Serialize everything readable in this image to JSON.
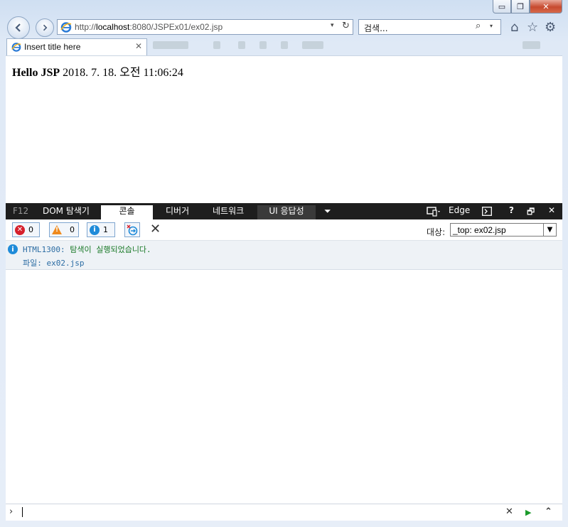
{
  "window": {
    "controls": {
      "minimize": "▭",
      "maximize": "❐",
      "close": "✕"
    }
  },
  "toolbar": {
    "back_icon": "arrow-left-icon",
    "forward_icon": "arrow-right-icon",
    "address": {
      "prefix": "http://",
      "host": "localhost",
      "rest": ":8080/JSPEx01/ex02.jsp",
      "dropdown": "▾",
      "refresh": "↻"
    },
    "search": {
      "placeholder": "검색...",
      "icon": "⌕",
      "dropdown": "▾"
    },
    "home": "⌂",
    "favorites": "☆",
    "settings": "⚙"
  },
  "tab": {
    "title": "Insert title here",
    "close": "✕"
  },
  "page": {
    "bold": "Hello JSP",
    "text": " 2018. 7. 18. 오전 11:06:24"
  },
  "devtools": {
    "f12": "F12",
    "tabs": [
      "DOM 탐색기",
      "콘솔",
      "디버거",
      "네트워크",
      "UI 응답성"
    ],
    "active_tab": "콘솔",
    "more": "⏷",
    "emulation": "Edge",
    "help": "?",
    "undock": "🗗",
    "close": "✕",
    "counts": {
      "errors": "0",
      "warnings": "0",
      "info": "1"
    },
    "clear": "✕",
    "target_label": "대상:",
    "target_value": "_top: ex02.jsp",
    "message": {
      "code": "HTML1300:",
      "text": " 탐색이 실행되었습니다.",
      "file": "파일: ex02.jsp"
    },
    "input": {
      "prompt": "›",
      "clear": "✕",
      "run": "▶",
      "expand": "⌃"
    }
  }
}
